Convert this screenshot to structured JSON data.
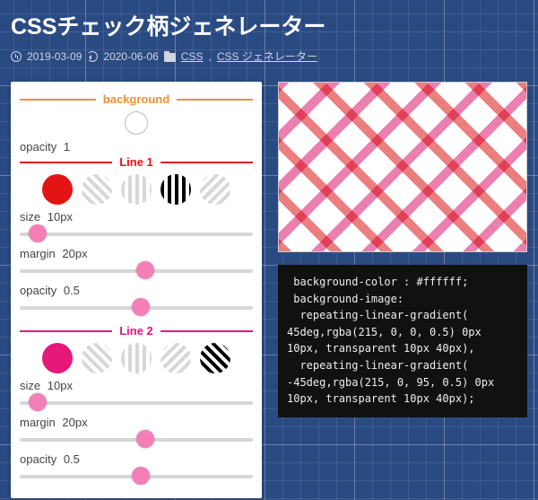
{
  "title": "CSSチェック柄ジェネレーター",
  "meta": {
    "published": "2019-03-09",
    "updated": "2020-06-06",
    "categories": [
      {
        "label": "CSS"
      },
      {
        "label": "CSS ジェネレーター"
      }
    ],
    "sep": " , "
  },
  "sections": {
    "background": {
      "title": "background",
      "opacity": {
        "label": "opacity",
        "value": "1"
      }
    },
    "line1": {
      "title": "Line 1",
      "size": {
        "label": "size",
        "value": "10px"
      },
      "margin": {
        "label": "margin",
        "value": "20px"
      },
      "opacity": {
        "label": "opacity",
        "value": "0.5"
      }
    },
    "line2": {
      "title": "Line 2",
      "size": {
        "label": "size",
        "value": "10px"
      },
      "margin": {
        "label": "margin",
        "value": "20px"
      },
      "opacity": {
        "label": "opacity",
        "value": "0.5"
      }
    }
  },
  "code": " background-color : #ffffff;\n background-image:\n  repeating-linear-gradient(\n45deg,rgba(215, 0, 0, 0.5) 0px 10px, transparent 10px 40px),\n  repeating-linear-gradient(\n-45deg,rgba(215, 0, 95, 0.5) 0px 10px, transparent 10px 40px);",
  "colors": {
    "accent_orange": "#f38e32",
    "accent_red": "#e41414",
    "accent_pink": "#e6187a",
    "knob": "#f37fb6"
  },
  "swatches": {
    "line1": [
      "solid-red",
      "gray-diag",
      "gray-vert",
      "black-vert",
      "gray-diag2"
    ],
    "line2": [
      "solid-pink",
      "gray-diag",
      "gray-vert",
      "gray-diag2",
      "black-diag"
    ]
  }
}
